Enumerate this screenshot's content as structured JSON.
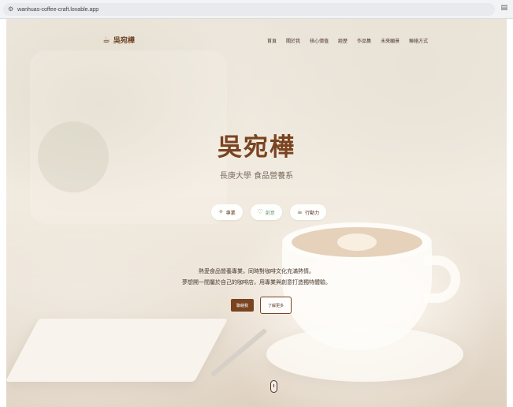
{
  "browser": {
    "url": "wanhuas-coffee-craft.lovable.app",
    "site_icon": "site-settings-icon",
    "reader_icon": "reader-mode-icon"
  },
  "brand": {
    "name": "吳宛樺",
    "icon": "coffee-cup-icon"
  },
  "nav": {
    "items": [
      {
        "label": "首頁"
      },
      {
        "label": "關於我"
      },
      {
        "label": "核心價值"
      },
      {
        "label": "經歷"
      },
      {
        "label": "作品集"
      },
      {
        "label": "未來願景"
      },
      {
        "label": "聯絡方式"
      }
    ]
  },
  "hero": {
    "title": "吳宛樺",
    "subtitle": "長庚大學 食品營養系",
    "tags": [
      {
        "label": "專業",
        "icon": "sparkle-icon"
      },
      {
        "label": "創意",
        "icon": "heart-icon"
      },
      {
        "label": "行動力",
        "icon": "coffee-cup-icon"
      }
    ],
    "intro_line1": "熱愛食品營養專業，同時對咖啡文化充滿熱情。",
    "intro_line2": "夢想開一間屬於自己的咖啡店，用專業與創意打造獨特體驗。",
    "primary_button": "聯絡我",
    "secondary_button": "了解更多",
    "scroll_icon": "scroll-mouse-icon"
  },
  "colors": {
    "brand_brown": "#7a4420",
    "accent_green": "#6e9d76",
    "text_dark": "#4a3426"
  }
}
